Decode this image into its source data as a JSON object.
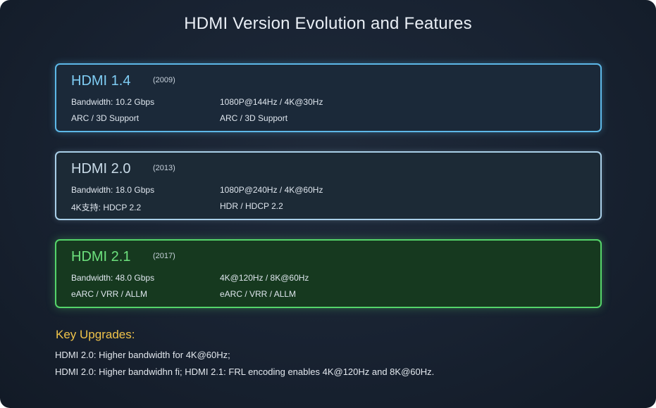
{
  "title": "HDMI Version Evolution and Features",
  "versions": [
    {
      "name": "HDMI 1.4",
      "year": "(2009)",
      "left": [
        "Bandwidth: 10.2 Gbps",
        "ARC / 3D Support"
      ],
      "right": [
        "1080P@144Hz / 4K@30Hz",
        "ARC / 3D Support"
      ],
      "accent": "#5db8e8"
    },
    {
      "name": "HDMI 2.0",
      "year": "(2013)",
      "left": [
        "Bandwidth: 18.0 Gbps",
        "4K支持: HDCP 2.2"
      ],
      "right": [
        "1080P@240Hz / 4K@60Hz",
        "HDR / HDCP 2.2"
      ],
      "accent": "#a9cfe8"
    },
    {
      "name": "HDMI 2.1",
      "year": "(2017)",
      "left": [
        "Bandwidth: 48.0 Gbps",
        "eARC / VRR / ALLM"
      ],
      "right": [
        "4K@120Hz / 8K@60Hz",
        "eARC / VRR / ALLM"
      ],
      "accent": "#55d46a"
    }
  ],
  "upgrades": {
    "heading": "Key Upgrades:",
    "lines": [
      "HDMI 2.0: Higher bandwidth for 4K@60Hz;",
      "HDMI 2.0: Higher bandwidhn fi; HDMI 2.1: FRL encoding enables 4K@120Hz and 8K@60Hz."
    ],
    "heading_color": "#f0c34a"
  }
}
